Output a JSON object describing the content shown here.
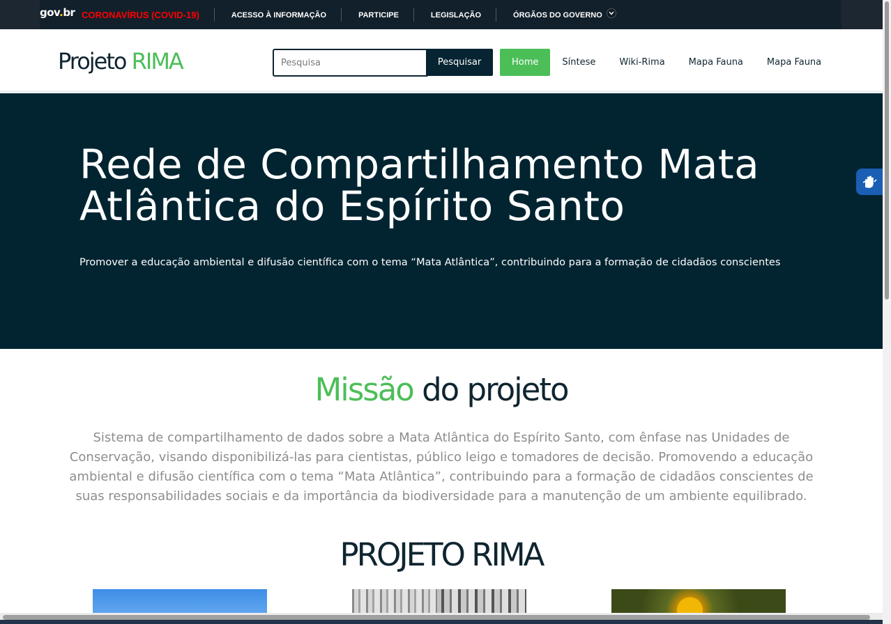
{
  "govbar": {
    "logo": "gov.br",
    "logo_main": "gov",
    "logo_dot": ".",
    "logo_tld": "br",
    "covid_link": "CORONAVÍRUS (COVID-19)",
    "links": [
      "ACESSO À INFORMAÇÃO",
      "PARTICIPE",
      "LEGISLAÇÃO",
      "ÓRGÃOS DO GOVERNO"
    ]
  },
  "header": {
    "brand_main": "Projeto ",
    "brand_accent": "RIMA",
    "search_placeholder": "Pesquisa",
    "search_button": "Pesquisar",
    "nav": [
      "Home",
      "Síntese",
      "Wiki-Rima",
      "Mapa Fauna",
      "Mapa Fauna"
    ],
    "active_nav": "Home"
  },
  "hero": {
    "title": "Rede de Compartilhamento Mata Atlântica do Espírito Santo",
    "subtitle": "Promover a educação ambiental e difusão científica com o tema “Mata Atlântica”, contribuindo para a formação de cidadãos conscientes"
  },
  "mission": {
    "title_accent": "Missão",
    "title_rest": " do projeto",
    "text": "Sistema de compartilhamento de dados sobre a Mata Atlântica do Espírito Santo, com ênfase nas Unidades de Conservação, visando disponibilizá-las para cientistas, público leigo e tomadores de decisão. Promovendo a educação ambiental e difusão científica com o tema “Mata Atlântica”, contribuindo para a formação de cidadãos conscientes de suas responsabilidades sociais e da importância da biodiversidade para a manutenção de um ambiente equilibrado."
  },
  "project_section": {
    "title": "PROJETO RIMA"
  },
  "accessibility": {
    "vlibras_icon": "sign-language-hands-icon"
  },
  "colors": {
    "accent_green": "#4cbe58",
    "dark_navy": "#022431",
    "covid_red": "#ff0000"
  }
}
